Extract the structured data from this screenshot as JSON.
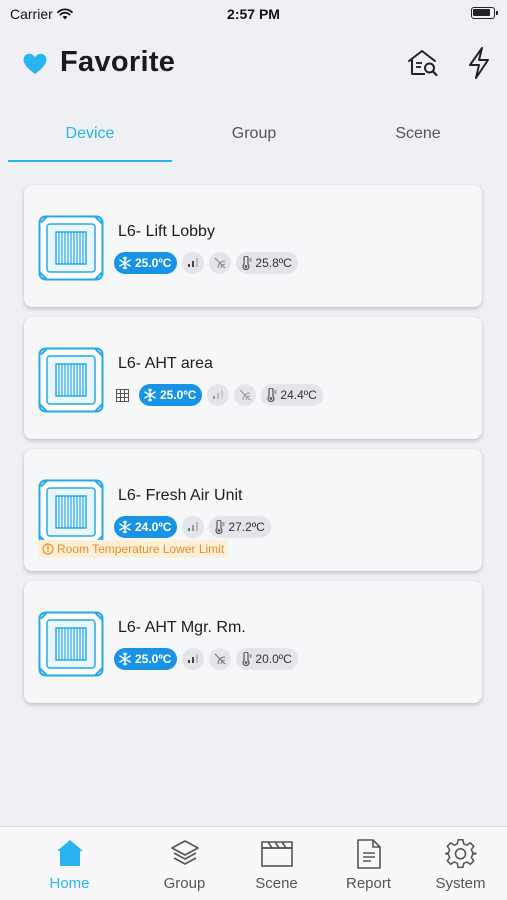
{
  "status_bar": {
    "carrier": "Carrier",
    "time": "2:57 PM"
  },
  "header": {
    "title": "Favorite",
    "icons": [
      "heart-icon",
      "house-search-icon",
      "lightning-icon"
    ]
  },
  "tabs": [
    {
      "label": "Device",
      "active": true
    },
    {
      "label": "Group",
      "active": false
    },
    {
      "label": "Scene",
      "active": false
    }
  ],
  "devices": [
    {
      "name": "L6- Lift Lobby",
      "mode_icon": "snowflake-icon",
      "setpoint": "25.0ºC",
      "room_temp": "25.8ºC"
    },
    {
      "name": "L6- AHT area",
      "mode_icon": "snowflake-icon",
      "setpoint": "25.0ºC",
      "room_temp": "24.4ºC"
    },
    {
      "name": "L6- Fresh Air Unit",
      "mode_icon": "snowflake-icon",
      "setpoint": "24.0ºC",
      "room_temp": "27.2ºC",
      "alarm": "Room Temperature Lower Limit"
    },
    {
      "name": "L6- AHT Mgr. Rm.",
      "mode_icon": "snowflake-icon",
      "setpoint": "25.0ºC",
      "room_temp": "20.0ºC"
    }
  ],
  "bottom_nav": [
    {
      "label": "Home",
      "icon": "home-icon",
      "active": true
    },
    {
      "label": "Group",
      "icon": "layers-icon",
      "active": false
    },
    {
      "label": "Scene",
      "icon": "clapperboard-icon",
      "active": false
    },
    {
      "label": "Report",
      "icon": "document-icon",
      "active": false
    },
    {
      "label": "System",
      "icon": "gear-icon",
      "active": false
    }
  ],
  "colors": {
    "accent": "#28b4ef",
    "mode_chip": "#1993e6",
    "alarm_text": "#f08a24",
    "alarm_bg": "#fdf0d8",
    "background": "#eef0f4"
  }
}
